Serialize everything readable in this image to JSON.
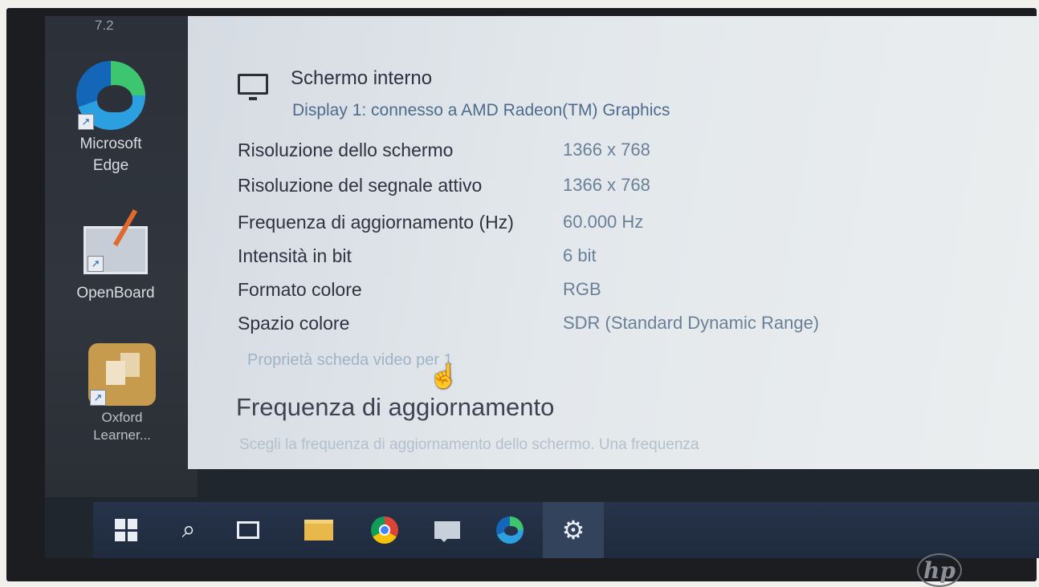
{
  "desktop": {
    "top_label": "7.2",
    "icons": [
      {
        "label_1": "Microsoft",
        "label_2": "Edge"
      },
      {
        "label_1": "OpenBoard",
        "label_2": ""
      },
      {
        "label_1": "Oxford",
        "label_2": "Learner..."
      }
    ]
  },
  "settings": {
    "display": {
      "title": "Schermo interno",
      "subtitle": "Display 1: connesso a AMD Radeon(TM) Graphics"
    },
    "info_rows": [
      {
        "label": "Risoluzione dello schermo",
        "value": "1366 x 768"
      },
      {
        "label": "Risoluzione del segnale attivo",
        "value": "1366 x 768"
      },
      {
        "label": "Frequenza di aggiornamento (Hz)",
        "value": "60.000 Hz"
      },
      {
        "label": "Intensità in bit",
        "value": "6 bit"
      },
      {
        "label": "Formato colore",
        "value": "RGB"
      },
      {
        "label": "Spazio colore",
        "value": "SDR (Standard Dynamic Range)"
      }
    ],
    "adapter_link": "Proprietà scheda video per 1",
    "refresh_section": {
      "title": "Frequenza di aggiornamento",
      "description": "Scegli la frequenza di aggiornamento dello schermo. Una frequenza"
    }
  },
  "taskbar": {
    "items": [
      "windows-start",
      "search",
      "task-view",
      "file-explorer",
      "chrome",
      "chat",
      "edge",
      "settings"
    ],
    "active": "settings"
  },
  "brand": "hp"
}
